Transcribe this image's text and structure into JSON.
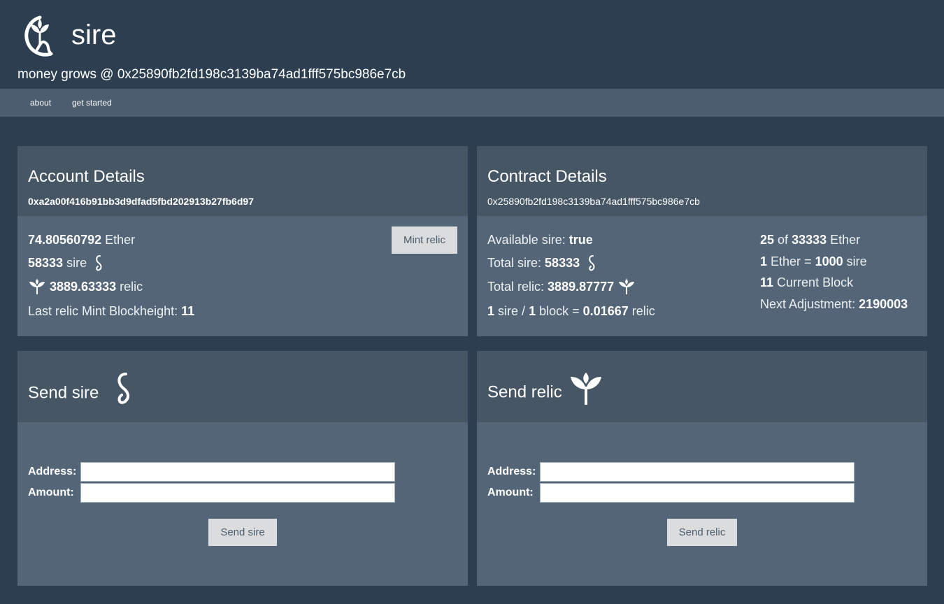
{
  "header": {
    "title": "sire",
    "tagline": "money grows @ 0x25890fb2fd198c3139ba74ad1fff575bc986e7cb"
  },
  "nav": {
    "about": "about",
    "get_started": "get started"
  },
  "account": {
    "title": "Account Details",
    "address": "0xa2a00f416b91bb3d9dfad5fbd202913b27fb6d97",
    "ether_value": "74.80560792",
    "ether_unit": "Ether",
    "sire_value": "58333",
    "sire_unit": "sire",
    "relic_value": "3889.63333",
    "relic_unit": "relic",
    "last_mint_label": "Last relic Mint Blockheight:",
    "last_mint_value": "11",
    "mint_button": "Mint relic"
  },
  "contract": {
    "title": "Contract Details",
    "address": "0x25890fb2fd198c3139ba74ad1fff575bc986e7cb",
    "available_label": "Available sire:",
    "available_value": "true",
    "total_sire_label": "Total sire:",
    "total_sire_value": "58333",
    "total_relic_label": "Total relic:",
    "total_relic_value": "3889.87777",
    "rate_sire_n": "1",
    "rate_sire_t": "sire /",
    "rate_block_n": "1",
    "rate_block_t": "block =",
    "rate_relic_n": "0.01667",
    "rate_relic_t": "relic",
    "raised_value": "25",
    "raised_of": "of",
    "cap_value": "33333",
    "cap_unit": "Ether",
    "price_ether_n": "1",
    "price_ether_t": "Ether =",
    "price_sire_n": "1000",
    "price_sire_t": "sire",
    "current_block_value": "11",
    "current_block_label": "Current Block",
    "next_adj_label": "Next Adjustment:",
    "next_adj_value": "2190003"
  },
  "send_sire": {
    "title": "Send sire",
    "address_label": "Address:",
    "amount_label": "Amount:",
    "address_value": "",
    "amount_value": "",
    "button": "Send sire"
  },
  "send_relic": {
    "title": "Send relic",
    "address_label": "Address:",
    "amount_label": "Amount:",
    "address_value": "",
    "amount_value": "",
    "button": "Send relic"
  },
  "icons": {
    "logo": "sprout-coin-logo-icon",
    "sire": "serpent-icon",
    "relic": "sprout-icon"
  },
  "colors": {
    "background": "#2c3e50",
    "nav": "#4b5d6e",
    "panel_head": "#475664",
    "panel_body": "#546577",
    "button": "#dadcdd"
  }
}
